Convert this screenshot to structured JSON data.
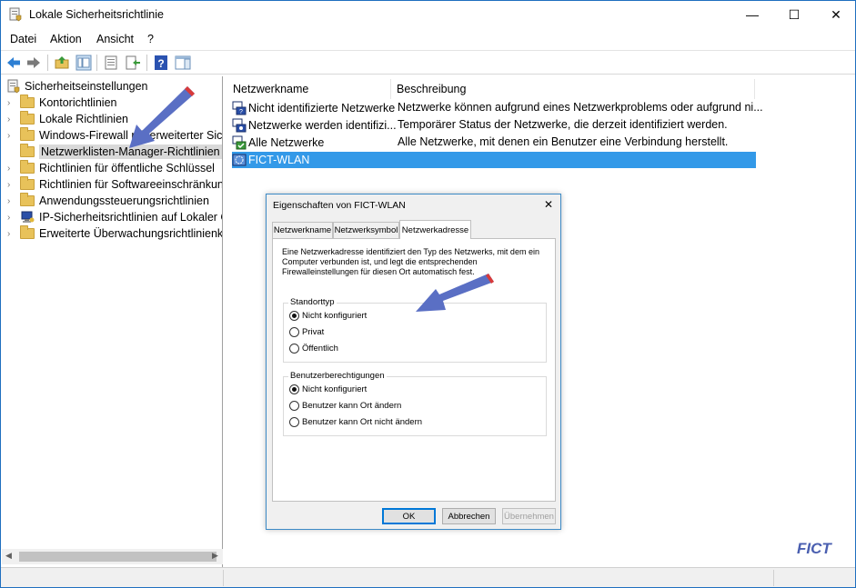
{
  "window": {
    "title": "Lokale Sicherheitsrichtlinie",
    "min_glyph": "—",
    "max_glyph": "☐",
    "close_glyph": "✕"
  },
  "menu": [
    "Datei",
    "Aktion",
    "Ansicht",
    "?"
  ],
  "toolbar": {
    "icons": [
      "back-icon",
      "forward-icon",
      "up-folder-icon",
      "show-hide-tree-icon",
      "properties-icon",
      "export-list-icon",
      "help-icon",
      "action-pane-icon"
    ]
  },
  "tree": {
    "root": "Sicherheitseinstellungen",
    "items": [
      {
        "label": "Kontorichtlinien",
        "icon": "folder-icon"
      },
      {
        "label": "Lokale Richtlinien",
        "icon": "folder-icon"
      },
      {
        "label": "Windows-Firewall mit erweiterter Sich",
        "icon": "folder-icon"
      },
      {
        "label": "Netzwerklisten-Manager-Richtlinien",
        "icon": "folder-icon",
        "selected": true
      },
      {
        "label": "Richtlinien für öffentliche Schlüssel",
        "icon": "folder-icon"
      },
      {
        "label": "Richtlinien für Softwareeinschränkung",
        "icon": "folder-icon"
      },
      {
        "label": "Anwendungssteuerungsrichtlinien",
        "icon": "folder-icon"
      },
      {
        "label": "IP-Sicherheitsrichtlinien auf Lokaler C",
        "icon": "ip-security-icon"
      },
      {
        "label": "Erweiterte Überwachungsrichtlinienko",
        "icon": "folder-icon"
      }
    ]
  },
  "list": {
    "columns": [
      "Netzwerkname",
      "Beschreibung"
    ],
    "rows": [
      {
        "name": "Nicht identifizierte Netzwerke",
        "description": "Netzwerke können aufgrund eines Netzwerkproblems oder aufgrund ni...",
        "icon": "network-unknown-icon"
      },
      {
        "name": "Netzwerke werden identifizi...",
        "description": "Temporärer Status der Netzwerke, die derzeit identifiziert werden.",
        "icon": "network-identifying-icon"
      },
      {
        "name": "Alle Netzwerke",
        "description": "Alle Netzwerke, mit denen ein Benutzer eine Verbindung herstellt.",
        "icon": "network-all-icon"
      },
      {
        "name": "FICT-WLAN",
        "description": "",
        "icon": "network-wlan-icon",
        "selected": true
      }
    ]
  },
  "dialog": {
    "title": "Eigenschaften von FICT-WLAN",
    "close_glyph": "✕",
    "tabs": [
      "Netzwerkname",
      "Netzwerksymbol",
      "Netzwerkadresse"
    ],
    "active_tab": "Netzwerkadresse",
    "intro": "Eine Netzwerkadresse identifiziert den Typ des Netzwerks, mit dem ein Computer verbunden ist, und legt die entsprechenden Firewalleinstellungen für diesen Ort automatisch fest.",
    "standorttyp": {
      "label": "Standorttyp",
      "options": [
        "Nicht konfiguriert",
        "Privat",
        "Öffentlich"
      ],
      "selected": "Nicht konfiguriert"
    },
    "benutzer": {
      "label": "Benutzerberechtigungen",
      "options": [
        "Nicht konfiguriert",
        "Benutzer kann Ort ändern",
        "Benutzer kann Ort nicht ändern"
      ],
      "selected": "Nicht konfiguriert"
    },
    "buttons": {
      "ok": "OK",
      "cancel": "Abbrechen",
      "apply": "Übernehmen"
    }
  },
  "watermark": "FICT",
  "colors": {
    "accent": "#3399e8",
    "arrow": "#5a6fc4",
    "watermark": "#4a5fb0"
  }
}
